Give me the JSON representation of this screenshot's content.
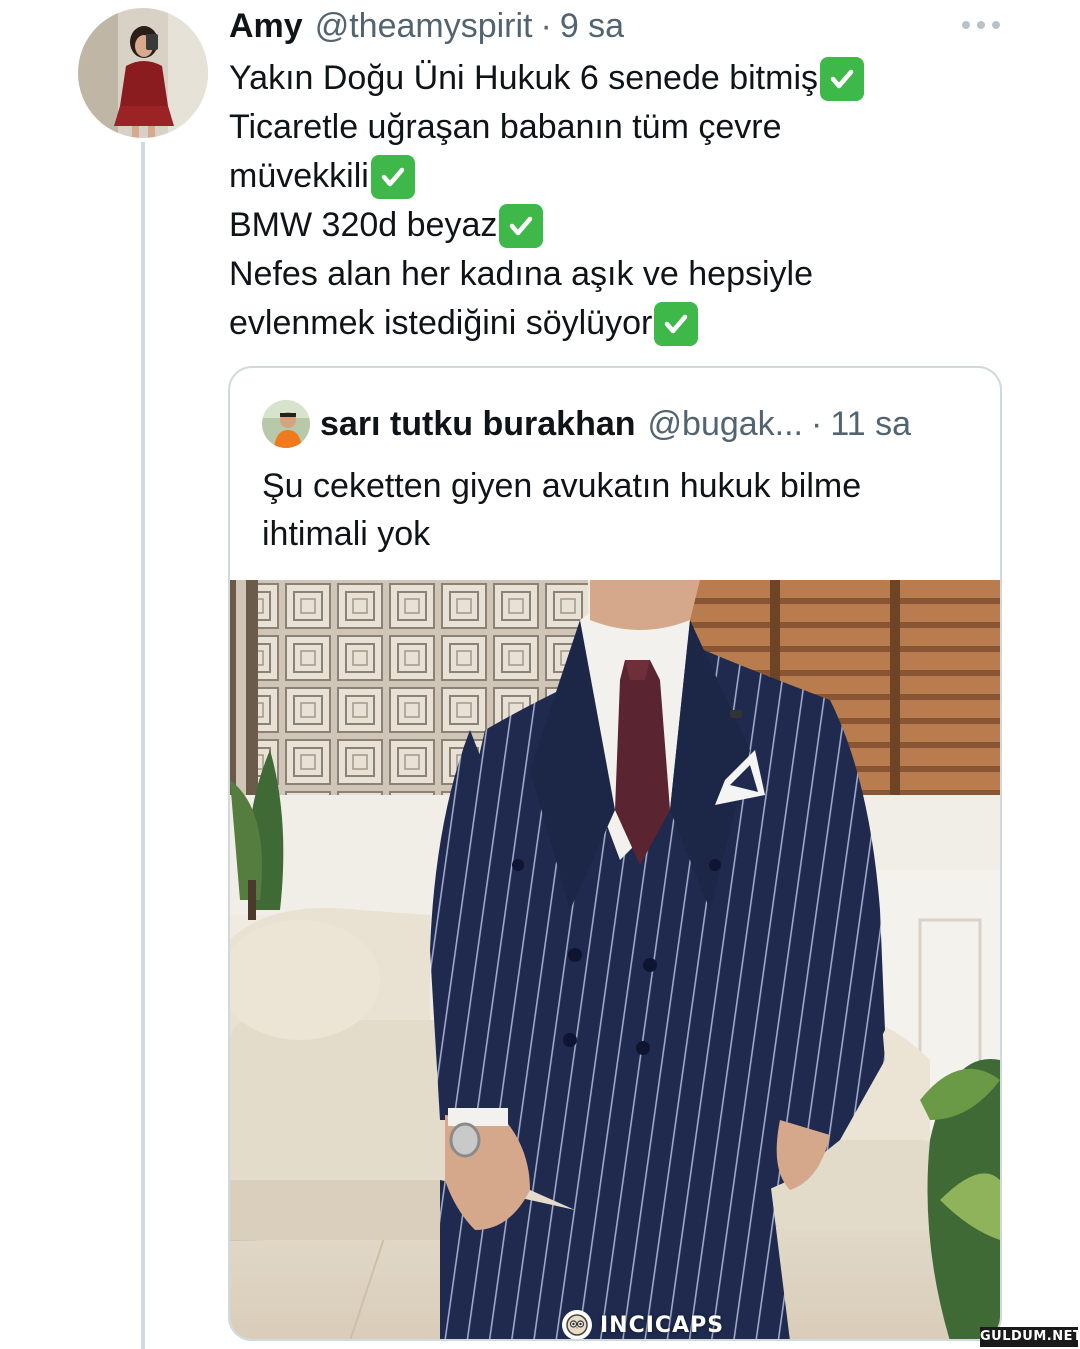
{
  "tweet": {
    "author_name": "Amy",
    "author_handle": "@theamyspirit",
    "separator": "·",
    "time": "9 sa",
    "lines": [
      "Yakın Doğu Üni Hukuk 6 senede bitmiş",
      "Ticaretle uğraşan babanın tüm çevre",
      "müvekkili",
      "BMW 320d beyaz",
      "Nefes alan her kadına aşık ve hepsiyle",
      "evlenmek istediğini söylüyor"
    ],
    "checkmark_emoji": "white-heavy-check-mark-icon"
  },
  "quoted_tweet": {
    "author_name": "sarı tutku burakhan",
    "author_handle": "@bugak...",
    "separator": "·",
    "time": "11 sa",
    "lines": [
      "Şu ceketten giyen avukatın hukuk bilme",
      "ihtimali yok"
    ],
    "media_description_icon": "photo-of-man-in-navy-pinstripe-double-breasted-suit"
  },
  "overlay": {
    "incicaps_logo": "INCICAPS",
    "watermark": "GULDUM.NET"
  },
  "colors": {
    "text_primary": "#0f1419",
    "text_secondary": "#536471",
    "border": "#cfd9de",
    "check_green": "#3fb84a",
    "suit_navy": "#1f2a4e"
  }
}
